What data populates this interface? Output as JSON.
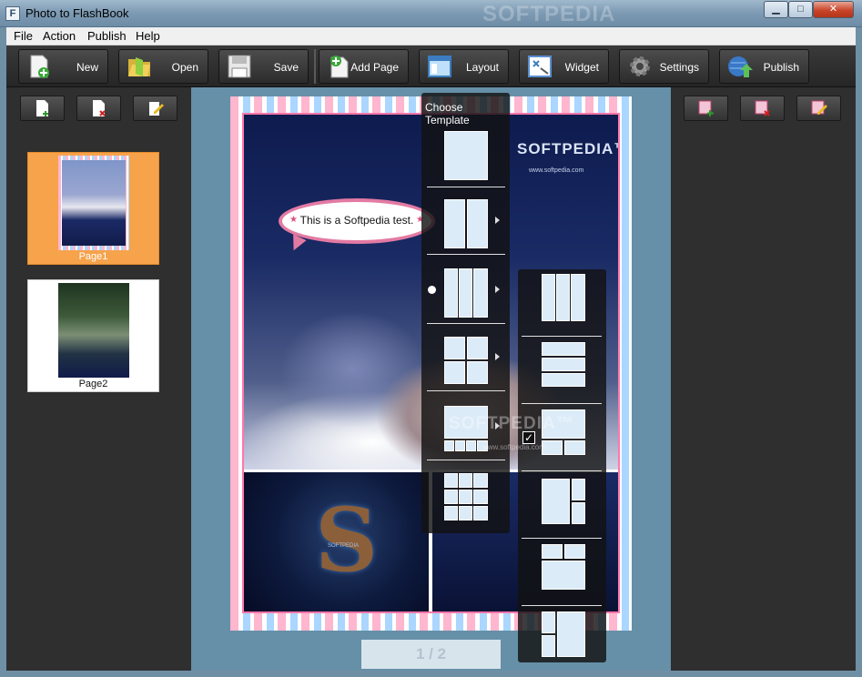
{
  "window": {
    "title": "Photo to FlashBook",
    "icon_letter": "F",
    "watermark": "SOFTPEDIA",
    "min_glyph": "▁",
    "max_glyph": "□",
    "close_glyph": "✕"
  },
  "menu": [
    "File",
    "Action",
    "Publish",
    "Help"
  ],
  "toolbar": [
    {
      "label": "New",
      "icon": "new-page-icon"
    },
    {
      "label": "Open",
      "icon": "folder-icon"
    },
    {
      "label": "Save",
      "icon": "disk-icon"
    },
    {
      "label": "Add Page",
      "icon": "add-page-icon"
    },
    {
      "label": "Layout",
      "icon": "layout-icon"
    },
    {
      "label": "Widget",
      "icon": "widget-icon"
    },
    {
      "label": "Settings",
      "icon": "gear-icon"
    },
    {
      "label": "Publish",
      "icon": "globe-upload-icon"
    }
  ],
  "left_panel": {
    "buttons": [
      "add-page-icon",
      "delete-page-icon",
      "edit-page-icon"
    ],
    "pages": [
      {
        "caption": "Page1",
        "selected": true
      },
      {
        "caption": "Page2",
        "selected": false
      }
    ]
  },
  "right_panel": {
    "buttons": [
      "add-photo-icon",
      "delete-photo-icon",
      "edit-photo-icon"
    ]
  },
  "page": {
    "brand": "SOFTPEDIA™",
    "brand_url": "www.softpedia.com",
    "bubble_text": "This is a Softpedia test.",
    "bubble_star": "★",
    "logo_letter": "S",
    "logo_caption": "SOFTPEDIA"
  },
  "pager": {
    "text": "1 / 2"
  },
  "template_menu": {
    "title": "Choose Template",
    "selected_index": 2
  },
  "submenu": {
    "checked_index": 2,
    "check_glyph": "✓",
    "watermark": "SOFTPEDIA™",
    "watermark_url": "www.softpedia.com"
  },
  "colors": {
    "toolbar_bg": "#2c2c2c",
    "panel_bg": "#2f2f2f",
    "selected_thumb": "#f6a34c",
    "workspace_bg": "#6690a8",
    "bubble_border": "#e37aa3"
  }
}
